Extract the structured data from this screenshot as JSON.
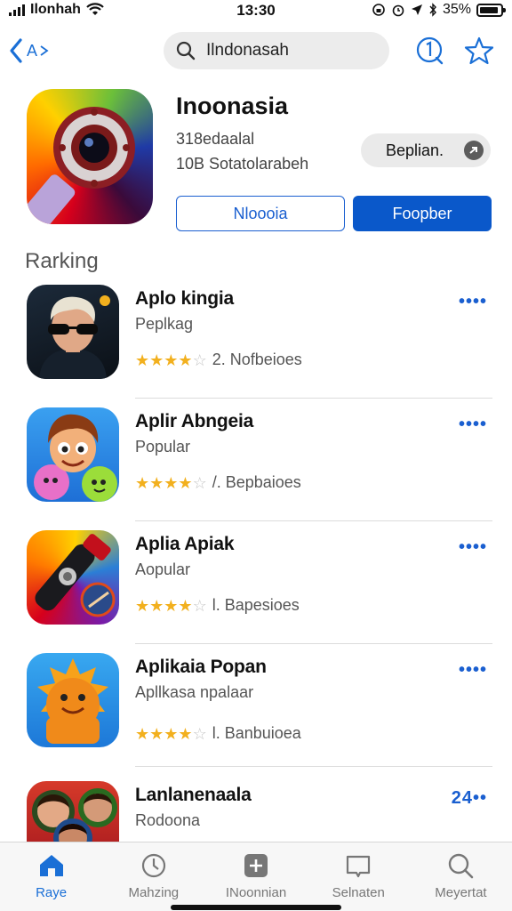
{
  "status": {
    "carrier": "Ilonhah",
    "time": "13:30",
    "battery": "35%"
  },
  "nav": {
    "back_label": "A",
    "search_text": "Ilndonasah"
  },
  "featured": {
    "title": "Inoonasia",
    "subtitle1": "318edaalal",
    "subtitle2": "10B Sotatolarabeh",
    "pill_label": "Beplian.",
    "outline_button": "Nloooia",
    "solid_button": "Foopber"
  },
  "section_title": "Rarking",
  "apps": [
    {
      "name": "Aplo kingia",
      "category": "Peplkag",
      "rating": 4.5,
      "rating_text": "2. Nofbeioes",
      "more": "••••"
    },
    {
      "name": "Aplir Abngeia",
      "category": "Popular",
      "rating": 4.5,
      "rating_text": "/. Bepbaioes",
      "more": "••••"
    },
    {
      "name": "Aplia Apiak",
      "category": "Aopular",
      "rating": 4.5,
      "rating_text": "l. Bapesioes",
      "more": "••••"
    },
    {
      "name": "Aplikaia Popan",
      "category": "Apllkasa npalaar",
      "rating": 4.5,
      "rating_text": "l. Banbuioea",
      "more": "••••"
    },
    {
      "name": "Lanlanenaala",
      "category": "Rodoona",
      "rating": null,
      "rating_text": "",
      "more": "24••"
    }
  ],
  "tabs": [
    {
      "label": "Raye",
      "icon": "home-icon",
      "active": true
    },
    {
      "label": "Mahzing",
      "icon": "clock-icon",
      "active": false
    },
    {
      "label": "INoonnian",
      "icon": "plus-square-icon",
      "active": false
    },
    {
      "label": "Selnaten",
      "icon": "book-icon",
      "active": false
    },
    {
      "label": "Meyertat",
      "icon": "search-icon",
      "active": false
    }
  ],
  "colors": {
    "accent": "#1a6fd6",
    "primary_button": "#0a58ca",
    "star": "#f2b01e"
  }
}
